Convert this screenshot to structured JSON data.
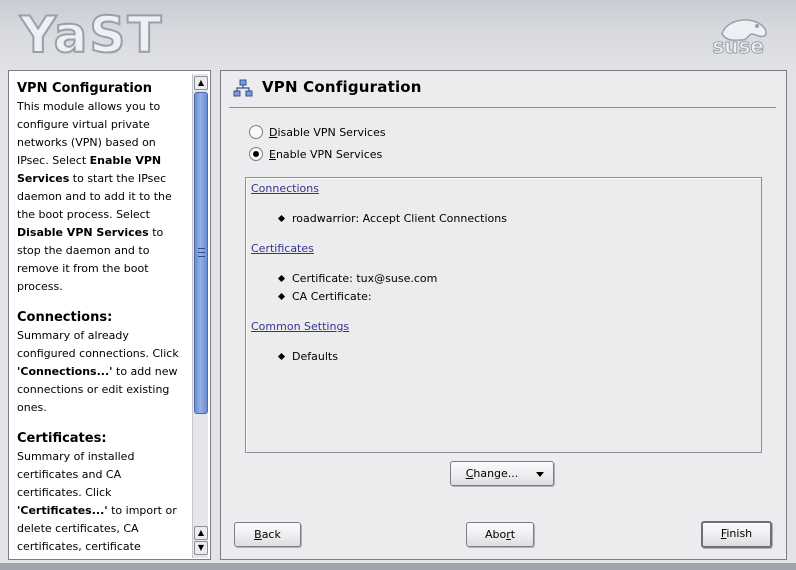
{
  "banner": {
    "app_logo": "YaST",
    "vendor_logo": "suse"
  },
  "help": {
    "title": "VPN Configuration",
    "intro_1": "This module allows you to configure virtual private networks (VPN) based on IPsec. Select ",
    "intro_enable": "Enable VPN Services",
    "intro_2": " to start the IPsec daemon and to add it to the the boot process. Select ",
    "intro_disable": "Disable VPN Services",
    "intro_3": " to stop the daemon and to remove it from the boot process.",
    "connections_heading": "Connections:",
    "connections_1": "Summary of already configured connections. Click ",
    "connections_btn": "'Connections...'",
    "connections_2": " to add new connections or edit existing ones.",
    "certificates_heading": "Certificates:",
    "certificates_1": "Summary of installed certificates and CA certificates. Click ",
    "certificates_btn": "'Certificates...'",
    "certificates_2": " to import or delete certificates, CA certificates, certificate"
  },
  "main": {
    "title": "VPN Configuration",
    "radios": {
      "disable_key": "D",
      "disable_rest": "isable VPN Services",
      "enable_key": "E",
      "enable_rest": "nable VPN Services",
      "selected": "enable"
    },
    "summary": {
      "connections_heading": "Connections",
      "connection_1": "roadwarrior: Accept Client Connections",
      "certificates_heading": "Certificates",
      "certificate_1": "Certificate: tux@suse.com",
      "certificate_2": "CA Certificate:",
      "common_heading": "Common Settings",
      "common_1": "Defaults"
    },
    "change_key": "C",
    "change_rest": "hange..."
  },
  "buttons": {
    "back_key": "B",
    "back_rest": "ack",
    "abort_pre": "Abo",
    "abort_key": "r",
    "abort_post": "t",
    "finish_key": "F",
    "finish_rest": "inish"
  },
  "colors": {
    "link": "#34348e",
    "scroll_thumb": "#7b9bd8",
    "banner": "#d3d5da"
  },
  "icons": {
    "title_icon": "network-icon",
    "dropdown": "chevron-down-icon",
    "scroll_up": "arrow-up-icon",
    "scroll_down": "arrow-down-icon"
  }
}
